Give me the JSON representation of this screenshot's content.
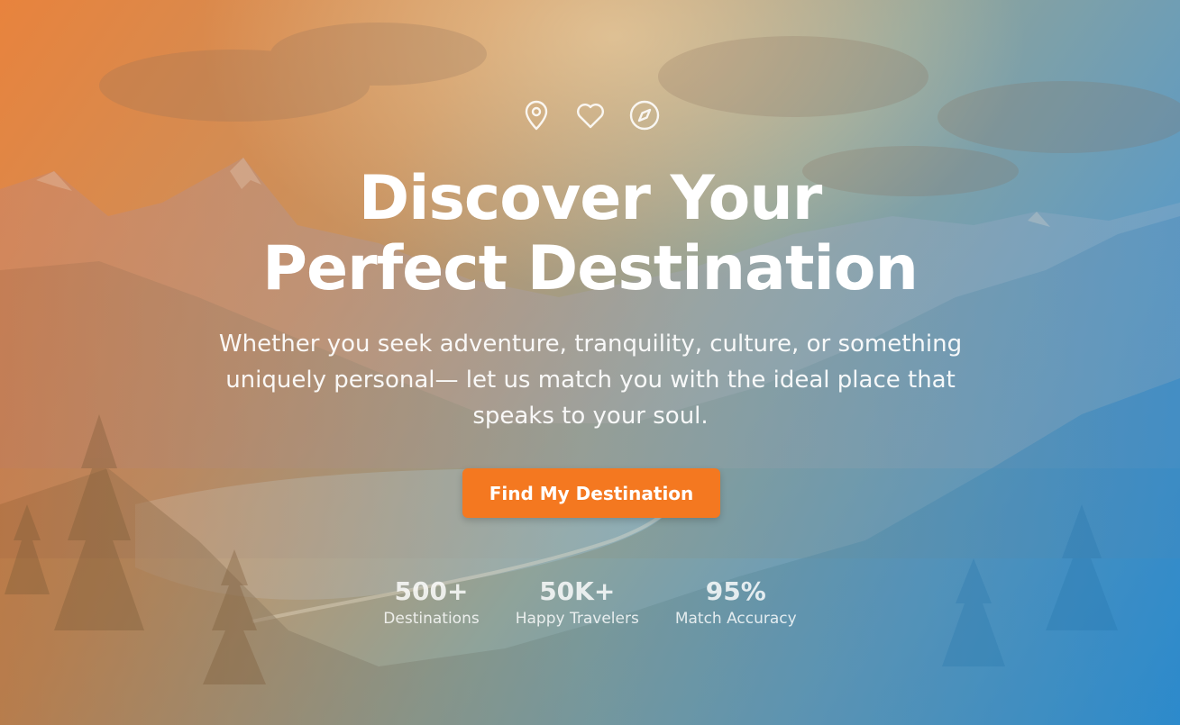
{
  "theme": {
    "accent": "#f47820",
    "gradient_start": "#e8833d",
    "gradient_end": "#2b8fd1"
  },
  "hero": {
    "icons": [
      "map-pin-icon",
      "heart-icon",
      "compass-icon"
    ],
    "title_line1": "Discover Your",
    "title_line2": "Perfect Destination",
    "subtitle": "Whether you seek adventure, tranquility, culture, or something uniquely personal— let us match you with the ideal place that speaks to your soul.",
    "cta_label": "Find My Destination"
  },
  "stats": [
    {
      "value": "500+",
      "label": "Destinations"
    },
    {
      "value": "50K+",
      "label": "Happy Travelers"
    },
    {
      "value": "95%",
      "label": "Match Accuracy"
    }
  ]
}
